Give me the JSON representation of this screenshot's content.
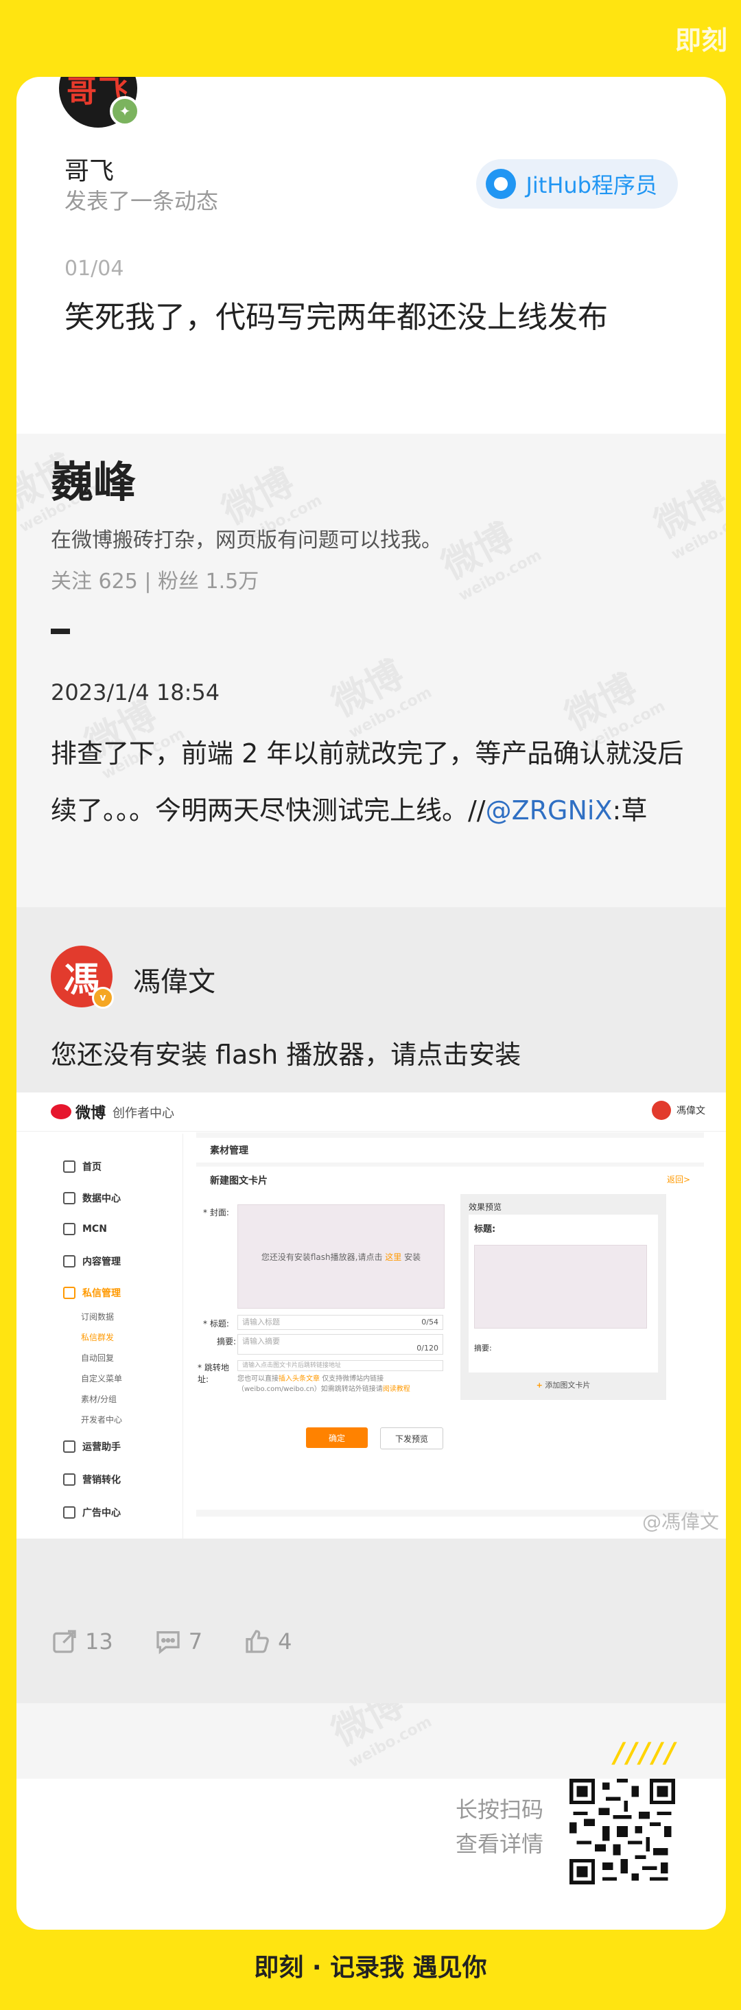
{
  "brand": {
    "top": "即刻",
    "bottom": "即刻 · 记录我 遇见你"
  },
  "post": {
    "avatar_text": "哥飞",
    "author": "哥飞",
    "action": "发表了一条动态",
    "topic": "JitHub程序员",
    "page_index": "01/04",
    "title": "笑死我了，代码写完两年都还没上线发布"
  },
  "weibo": {
    "watermark": "微博",
    "watermark_sub": "weibo.com",
    "profile_name": "巍峰",
    "bio": "在微博搬砖打杂，网页版有问题可以找我。",
    "stats": "关注 625 | 粉丝 1.5万",
    "date": "2023/1/4 18:54",
    "content_main": "排查了下，前端 2 年以前就改完了，等产品确认就没后续了。。。今明两天尽快测试完上线。//",
    "content_mention": "@ZRGNiX",
    "content_tail": ":草",
    "retweet": {
      "avatar_text": "馮",
      "name": "馮偉文",
      "text": "您还没有安装 flash 播放器，请点击安装",
      "embed": {
        "logo": "微博",
        "center": "创作者中心",
        "user": "馮偉文",
        "header": "素材管理",
        "panel_title": "新建图文卡片",
        "back": "返回>",
        "cover_label": "* 封面:",
        "flash_text": "您还没有安装flash播放器,请点击",
        "flash_link": "这里",
        "flash_tail": "安装",
        "title_label": "* 标题:",
        "title_placeholder": "请输入标题",
        "title_count": "0/54",
        "summary_label": "摘要:",
        "summary_placeholder": "请输入摘要",
        "summary_count": "0/120",
        "link_label": "* 跳转地址:",
        "link_placeholder": "请输入点击图文卡片后跳转链接地址",
        "note_1": "您也可以直接",
        "note_link": "插入头条文章",
        "note_2": "仅支持微博站内链接（weibo.com/weibo.cn）如需跳转站外链接请",
        "note_link2": "阅读教程",
        "preview_label": "效果预览",
        "preview_title": "标题:",
        "preview_summary": "摘要:",
        "add_card": "添加图文卡片",
        "ok": "确定",
        "save": "下发预览",
        "watermark": "@馮偉文",
        "side": {
          "home": "首页",
          "data": "数据中心",
          "mcn": "MCN",
          "content": "内容管理",
          "fans": "私信管理",
          "subs": [
            "订阅数据",
            "私信群发",
            "自动回复",
            "自定义菜单",
            "素材/分组",
            "开发者中心"
          ],
          "ops": "运营助手",
          "marketing": "营销转化",
          "ads": "广告中心"
        }
      }
    },
    "actions": {
      "reposts": "13",
      "comments": "7",
      "likes": "4"
    }
  },
  "footer": {
    "slashes": "/////",
    "scan_1": "长按扫码",
    "scan_2": "查看详情"
  }
}
